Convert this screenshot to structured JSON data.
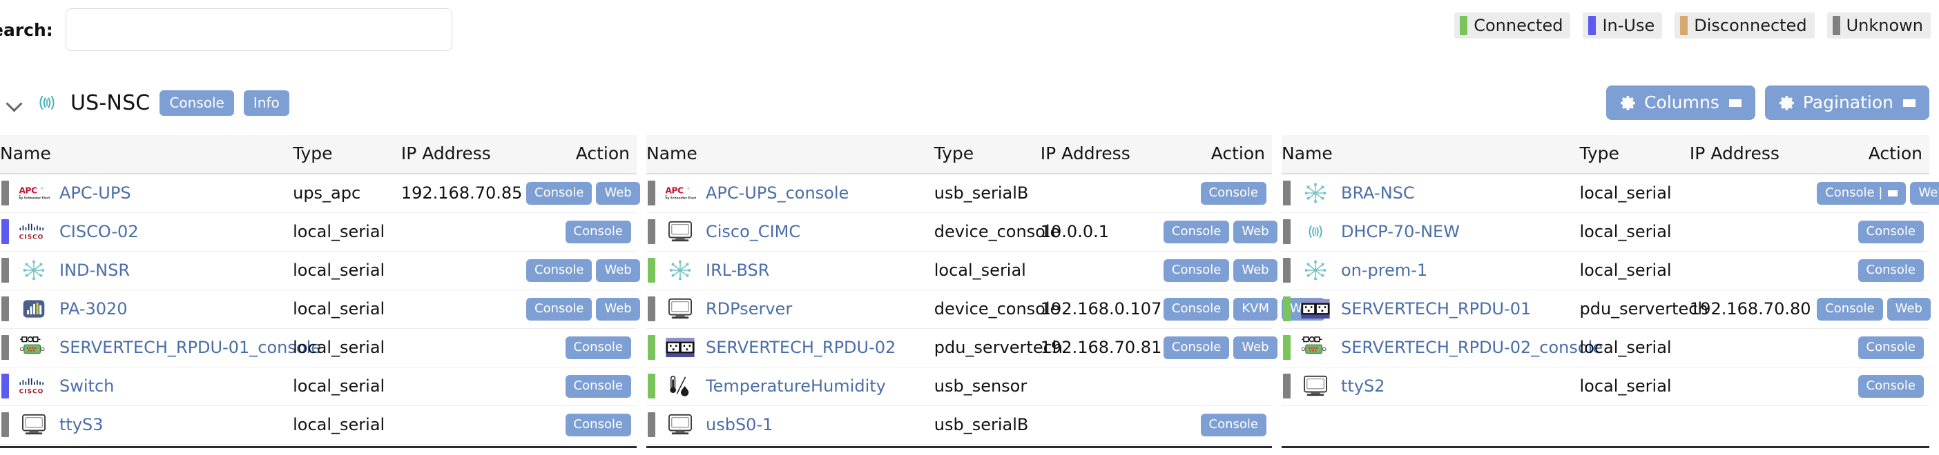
{
  "search": {
    "label": "Search:",
    "value": "",
    "placeholder": ""
  },
  "legend": [
    {
      "label": "Connected",
      "color": "#7ac45c"
    },
    {
      "label": "In-Use",
      "color": "#5b5bef"
    },
    {
      "label": "Disconnected",
      "color": "#d6a86f"
    },
    {
      "label": "Unknown",
      "color": "#808080"
    }
  ],
  "group": {
    "title": "US-NSC",
    "icon": "nodegrid-signal-icon",
    "expanded": true,
    "console_label": "Console",
    "info_label": "Info"
  },
  "toolbar": {
    "columns_label": "Columns",
    "pagination_label": "Pagination"
  },
  "columns": [
    "Name",
    "Type",
    "IP Address",
    "Action"
  ],
  "accent": "#7d9fd3",
  "link_color": "#4a6ea9",
  "tables": [
    {
      "rows": [
        {
          "status": "unknown",
          "icon": "apc-logo-icon",
          "name": "APC-UPS",
          "type": "ups_apc",
          "ip": "192.168.70.85",
          "actions": [
            "Console",
            "Web"
          ]
        },
        {
          "status": "in-use",
          "icon": "cisco-logo-icon",
          "name": "CISCO-02",
          "type": "local_serial",
          "ip": "",
          "actions": [
            "Console"
          ]
        },
        {
          "status": "unknown",
          "icon": "network-node-icon",
          "name": "IND-NSR",
          "type": "local_serial",
          "ip": "",
          "actions": [
            "Console",
            "Web"
          ]
        },
        {
          "status": "unknown",
          "icon": "firewall-chart-icon",
          "name": "PA-3020",
          "type": "local_serial",
          "ip": "",
          "actions": [
            "Console",
            "Web"
          ]
        },
        {
          "status": "unknown",
          "icon": "serial-console-icon",
          "name": "SERVERTECH_RPDU-01_console",
          "type": "local_serial",
          "ip": "",
          "actions": [
            "Console"
          ]
        },
        {
          "status": "in-use",
          "icon": "cisco-logo-icon",
          "name": "Switch",
          "type": "local_serial",
          "ip": "",
          "actions": [
            "Console"
          ]
        },
        {
          "status": "unknown",
          "icon": "monitor-icon",
          "name": "ttyS3",
          "type": "local_serial",
          "ip": "",
          "actions": [
            "Console"
          ]
        }
      ]
    },
    {
      "rows": [
        {
          "status": "unknown",
          "icon": "apc-logo-icon",
          "name": "APC-UPS_console",
          "type": "usb_serialB",
          "ip": "",
          "actions": [
            "Console"
          ]
        },
        {
          "status": "unknown",
          "icon": "monitor-icon",
          "name": "Cisco_CIMC",
          "type": "device_console",
          "ip": "10.0.0.1",
          "actions": [
            "Console",
            "Web"
          ]
        },
        {
          "status": "connected",
          "icon": "network-node-icon",
          "name": "IRL-BSR",
          "type": "local_serial",
          "ip": "",
          "actions": [
            "Console",
            "Web"
          ]
        },
        {
          "status": "unknown",
          "icon": "monitor-icon",
          "name": "RDPserver",
          "type": "device_console",
          "ip": "192.168.0.107",
          "actions": [
            "Console",
            "KVM",
            "Web"
          ]
        },
        {
          "status": "connected",
          "icon": "pdu-outlet-icon",
          "name": "SERVERTECH_RPDU-02",
          "type": "pdu_servertech",
          "ip": "192.168.70.81",
          "actions": [
            "Console",
            "Web"
          ]
        },
        {
          "status": "connected",
          "icon": "temp-humidity-icon",
          "name": "TemperatureHumidity",
          "type": "usb_sensor",
          "ip": "",
          "actions": []
        },
        {
          "status": "unknown",
          "icon": "monitor-icon",
          "name": "usbS0-1",
          "type": "usb_serialB",
          "ip": "",
          "actions": [
            "Console"
          ]
        }
      ]
    },
    {
      "rows": [
        {
          "status": "unknown",
          "icon": "network-node-icon",
          "name": "BRA-NSC",
          "type": "local_serial",
          "ip": "",
          "actions": [
            "Console|",
            "Web"
          ]
        },
        {
          "status": "unknown",
          "icon": "nodegrid-signal-icon",
          "name": "DHCP-70-NEW",
          "type": "local_serial",
          "ip": "",
          "actions": [
            "Console"
          ]
        },
        {
          "status": "unknown",
          "icon": "network-node-icon",
          "name": "on-prem-1",
          "type": "local_serial",
          "ip": "",
          "actions": [
            "Console"
          ]
        },
        {
          "status": "connected",
          "icon": "pdu-outlet-icon",
          "name": "SERVERTECH_RPDU-01",
          "type": "pdu_servertech",
          "ip": "192.168.70.80",
          "actions": [
            "Console",
            "Web"
          ]
        },
        {
          "status": "connected",
          "icon": "serial-console-icon",
          "name": "SERVERTECH_RPDU-02_console",
          "type": "local_serial",
          "ip": "",
          "actions": [
            "Console"
          ]
        },
        {
          "status": "unknown",
          "icon": "monitor-icon",
          "name": "ttyS2",
          "type": "local_serial",
          "ip": "",
          "actions": [
            "Console"
          ]
        }
      ]
    }
  ]
}
